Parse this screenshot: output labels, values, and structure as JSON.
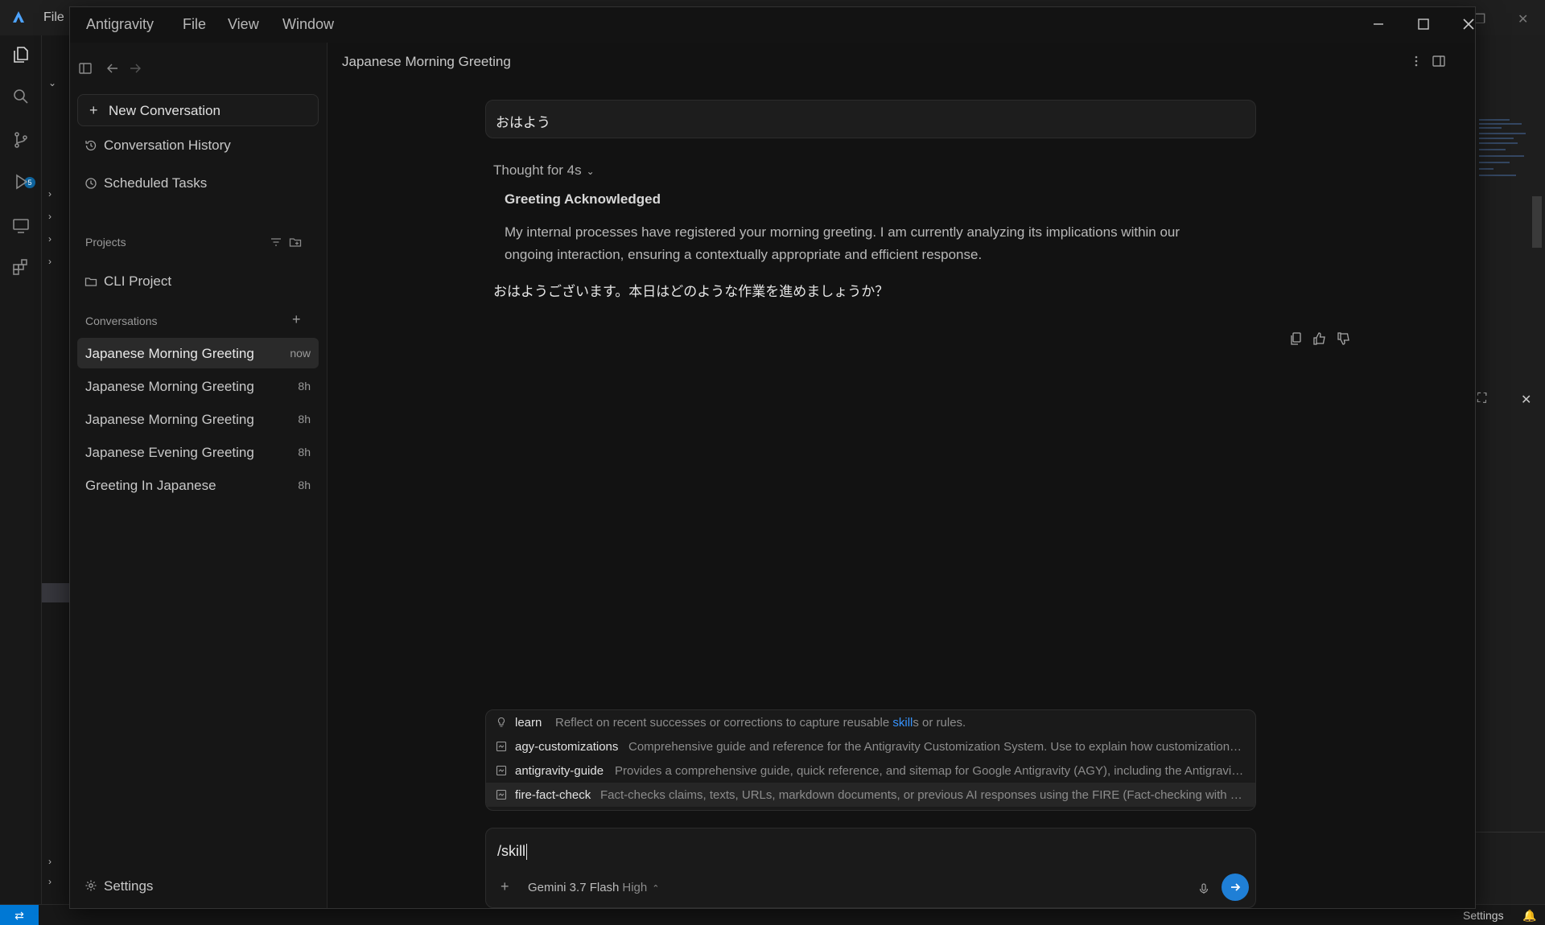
{
  "background": {
    "menu_file": "File",
    "statusbar_settings": "Settings",
    "scm_badge": "5"
  },
  "window": {
    "menu": [
      "Antigravity",
      "File",
      "View",
      "Window"
    ]
  },
  "sidebar": {
    "new_conversation": "New Conversation",
    "conversation_history": "Conversation History",
    "scheduled_tasks": "Scheduled Tasks",
    "projects_heading": "Projects",
    "projects": [
      {
        "label": "CLI Project"
      }
    ],
    "conversations_heading": "Conversations",
    "conversations": [
      {
        "title": "Japanese Morning Greeting",
        "time": "now",
        "active": true
      },
      {
        "title": "Japanese Morning Greeting",
        "time": "8h",
        "active": false
      },
      {
        "title": "Japanese Morning Greeting",
        "time": "8h",
        "active": false
      },
      {
        "title": "Japanese Evening Greeting",
        "time": "8h",
        "active": false
      },
      {
        "title": "Greeting In Japanese",
        "time": "8h",
        "active": false
      }
    ],
    "settings": "Settings"
  },
  "main": {
    "title": "Japanese Morning Greeting",
    "user_message": "おはよう",
    "thought_label": "Thought for 4s",
    "thought_heading": "Greeting Acknowledged",
    "thought_body": "My internal processes have registered your morning greeting. I am currently analyzing its implications within our ongoing interaction, ensuring a contextually appropriate and efficient response.",
    "reply": "おはようございます。本日はどのような作業を進めましょうか？"
  },
  "suggestions": [
    {
      "icon": "lightbulb-icon",
      "name": "learn",
      "desc_pre": "Reflect on recent successes or corrections to capture reusable ",
      "desc_hl": "skill",
      "desc_post": "s or rules."
    },
    {
      "icon": "skill-icon",
      "name": "agy-customizations",
      "desc": "Comprehensive guide and reference for the Antigravity Customization System. Use to explain how customizations ..."
    },
    {
      "icon": "skill-icon",
      "name": "antigravity-guide",
      "desc": "Provides a comprehensive guide, quick reference, and sitemap for Google Antigravity (AGY), including the Antigravity..."
    },
    {
      "icon": "skill-icon",
      "name": "fire-fact-check",
      "desc": "Fact-checks claims, texts, URLs, markdown documents, or previous AI responses using the FIRE (Fact-checking with Iterat..."
    }
  ],
  "composer": {
    "input_value": "/skill",
    "model_name": "Gemini 3.7 Flash",
    "model_level": "High"
  },
  "colors": {
    "accent": "#1f7fd6",
    "highlight": "#3794ff"
  }
}
